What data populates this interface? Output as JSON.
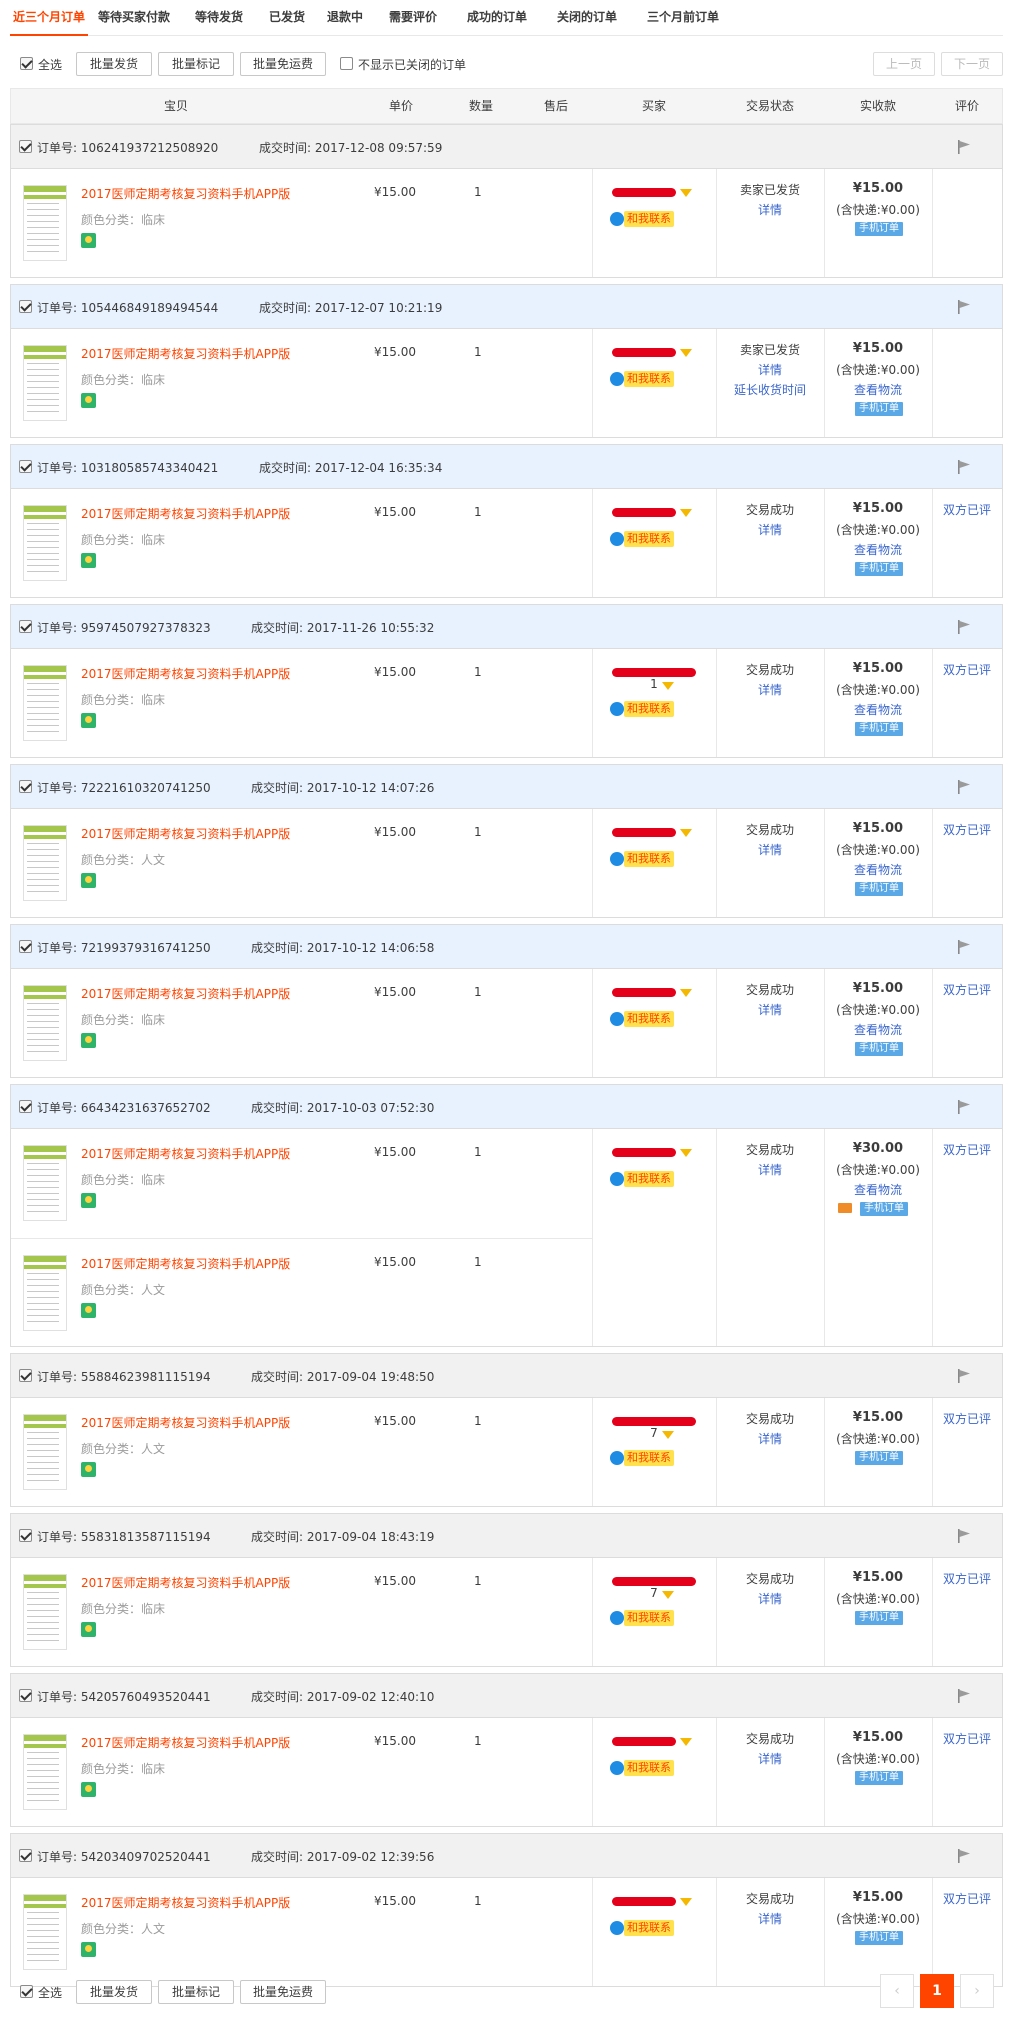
{
  "tabs": [
    {
      "label": "近三个月订单",
      "active": true
    },
    {
      "label": "等待买家付款"
    },
    {
      "label": "等待发货"
    },
    {
      "label": "已发货"
    },
    {
      "label": "退款中"
    },
    {
      "label": "需要评价"
    },
    {
      "label": "成功的订单"
    },
    {
      "label": "关闭的订单"
    },
    {
      "label": "三个月前订单"
    }
  ],
  "toolbar": {
    "select_all": "全选",
    "batch_ship": "批量发货",
    "batch_mark": "批量标记",
    "batch_free_shipping": "批量免运费",
    "hide_closed": "不显示已关闭的订单",
    "prev_page": "上一页",
    "next_page": "下一页"
  },
  "columns": {
    "item": "宝贝",
    "unit_price": "单价",
    "quantity": "数量",
    "after_sale": "售后",
    "buyer": "买家",
    "status": "交易状态",
    "paid": "实收款",
    "review": "评价"
  },
  "labels": {
    "order_no": "订单号:",
    "deal_time": "成交时间:",
    "contact": "和我联系",
    "mobile_order": "手机订单"
  },
  "orders": [
    {
      "id": "106241937212508920",
      "time": "2017-12-08 09:57:59",
      "header": "gray",
      "status": "卖家已发货",
      "links": [
        "详情"
      ],
      "paid": "¥15.00",
      "shipping": "(含快递:¥0.00)",
      "pay_links": [],
      "review": "",
      "buyer_line2": "",
      "items": [
        {
          "title": "2017医师定期考核复习资料手机APP版",
          "sku": "颜色分类：临床",
          "price": "¥15.00",
          "qty": "1"
        }
      ]
    },
    {
      "id": "105446849189494544",
      "time": "2017-12-07 10:21:19",
      "header": "blue",
      "status": "卖家已发货",
      "links": [
        "详情",
        "延长收货时间"
      ],
      "paid": "¥15.00",
      "shipping": "(含快递:¥0.00)",
      "pay_links": [
        "查看物流"
      ],
      "review": "",
      "buyer_line2": "",
      "items": [
        {
          "title": "2017医师定期考核复习资料手机APP版",
          "sku": "颜色分类：临床",
          "price": "¥15.00",
          "qty": "1"
        }
      ]
    },
    {
      "id": "103180585743340421",
      "time": "2017-12-04 16:35:34",
      "header": "blue",
      "status": "交易成功",
      "links": [
        "详情"
      ],
      "paid": "¥15.00",
      "shipping": "(含快递:¥0.00)",
      "pay_links": [
        "查看物流"
      ],
      "review": "双方已评",
      "buyer_line2": "",
      "items": [
        {
          "title": "2017医师定期考核复习资料手机APP版",
          "sku": "颜色分类：临床",
          "price": "¥15.00",
          "qty": "1"
        }
      ]
    },
    {
      "id": "95974507927378323",
      "time": "2017-11-26 10:55:32",
      "header": "blue",
      "status": "交易成功",
      "links": [
        "详情"
      ],
      "paid": "¥15.00",
      "shipping": "(含快递:¥0.00)",
      "pay_links": [
        "查看物流"
      ],
      "review": "双方已评",
      "buyer_line2": "1",
      "items": [
        {
          "title": "2017医师定期考核复习资料手机APP版",
          "sku": "颜色分类：临床",
          "price": "¥15.00",
          "qty": "1"
        }
      ]
    },
    {
      "id": "72221610320741250",
      "time": "2017-10-12 14:07:26",
      "header": "blue",
      "status": "交易成功",
      "links": [
        "详情"
      ],
      "paid": "¥15.00",
      "shipping": "(含快递:¥0.00)",
      "pay_links": [
        "查看物流"
      ],
      "review": "双方已评",
      "buyer_line2": "",
      "items": [
        {
          "title": "2017医师定期考核复习资料手机APP版",
          "sku": "颜色分类：人文",
          "price": "¥15.00",
          "qty": "1"
        }
      ]
    },
    {
      "id": "72199379316741250",
      "time": "2017-10-12 14:06:58",
      "header": "blue",
      "status": "交易成功",
      "links": [
        "详情"
      ],
      "paid": "¥15.00",
      "shipping": "(含快递:¥0.00)",
      "pay_links": [
        "查看物流"
      ],
      "review": "双方已评",
      "buyer_line2": "",
      "items": [
        {
          "title": "2017医师定期考核复习资料手机APP版",
          "sku": "颜色分类：临床",
          "price": "¥15.00",
          "qty": "1"
        }
      ]
    },
    {
      "id": "66434231637652702",
      "time": "2017-10-03 07:52:30",
      "header": "blue",
      "status": "交易成功",
      "links": [
        "详情"
      ],
      "paid": "¥30.00",
      "shipping": "(含快递:¥0.00)",
      "pay_links": [
        "查看物流"
      ],
      "review": "双方已评",
      "buyer_line2": "",
      "card": true,
      "items": [
        {
          "title": "2017医师定期考核复习资料手机APP版",
          "sku": "颜色分类：临床",
          "price": "¥15.00",
          "qty": "1"
        },
        {
          "title": "2017医师定期考核复习资料手机APP版",
          "sku": "颜色分类：人文",
          "price": "¥15.00",
          "qty": "1"
        }
      ]
    },
    {
      "id": "55884623981115194",
      "time": "2017-09-04 19:48:50",
      "header": "gray",
      "status": "交易成功",
      "links": [
        "详情"
      ],
      "paid": "¥15.00",
      "shipping": "(含快递:¥0.00)",
      "pay_links": [],
      "review": "双方已评",
      "buyer_line2": "7",
      "items": [
        {
          "title": "2017医师定期考核复习资料手机APP版",
          "sku": "颜色分类：人文",
          "price": "¥15.00",
          "qty": "1"
        }
      ]
    },
    {
      "id": "55831813587115194",
      "time": "2017-09-04 18:43:19",
      "header": "gray",
      "status": "交易成功",
      "links": [
        "详情"
      ],
      "paid": "¥15.00",
      "shipping": "(含快递:¥0.00)",
      "pay_links": [],
      "review": "双方已评",
      "buyer_line2": "7",
      "items": [
        {
          "title": "2017医师定期考核复习资料手机APP版",
          "sku": "颜色分类：临床",
          "price": "¥15.00",
          "qty": "1"
        }
      ]
    },
    {
      "id": "54205760493520441",
      "time": "2017-09-02 12:40:10",
      "header": "gray",
      "status": "交易成功",
      "links": [
        "详情"
      ],
      "paid": "¥15.00",
      "shipping": "(含快递:¥0.00)",
      "pay_links": [],
      "review": "双方已评",
      "buyer_line2": "",
      "items": [
        {
          "title": "2017医师定期考核复习资料手机APP版",
          "sku": "颜色分类：临床",
          "price": "¥15.00",
          "qty": "1"
        }
      ]
    },
    {
      "id": "54203409702520441",
      "time": "2017-09-02 12:39:56",
      "header": "gray",
      "status": "交易成功",
      "links": [
        "详情"
      ],
      "paid": "¥15.00",
      "shipping": "(含快递:¥0.00)",
      "pay_links": [],
      "review": "双方已评",
      "buyer_line2": "",
      "items": [
        {
          "title": "2017医师定期考核复习资料手机APP版",
          "sku": "颜色分类：人文",
          "price": "¥15.00",
          "qty": "1"
        }
      ]
    }
  ],
  "pagination": {
    "prev": "‹",
    "current": "1",
    "next": "›"
  },
  "colors": {
    "accent": "#ff4400",
    "link": "#3a66cc",
    "title_red": "#ff4400"
  }
}
